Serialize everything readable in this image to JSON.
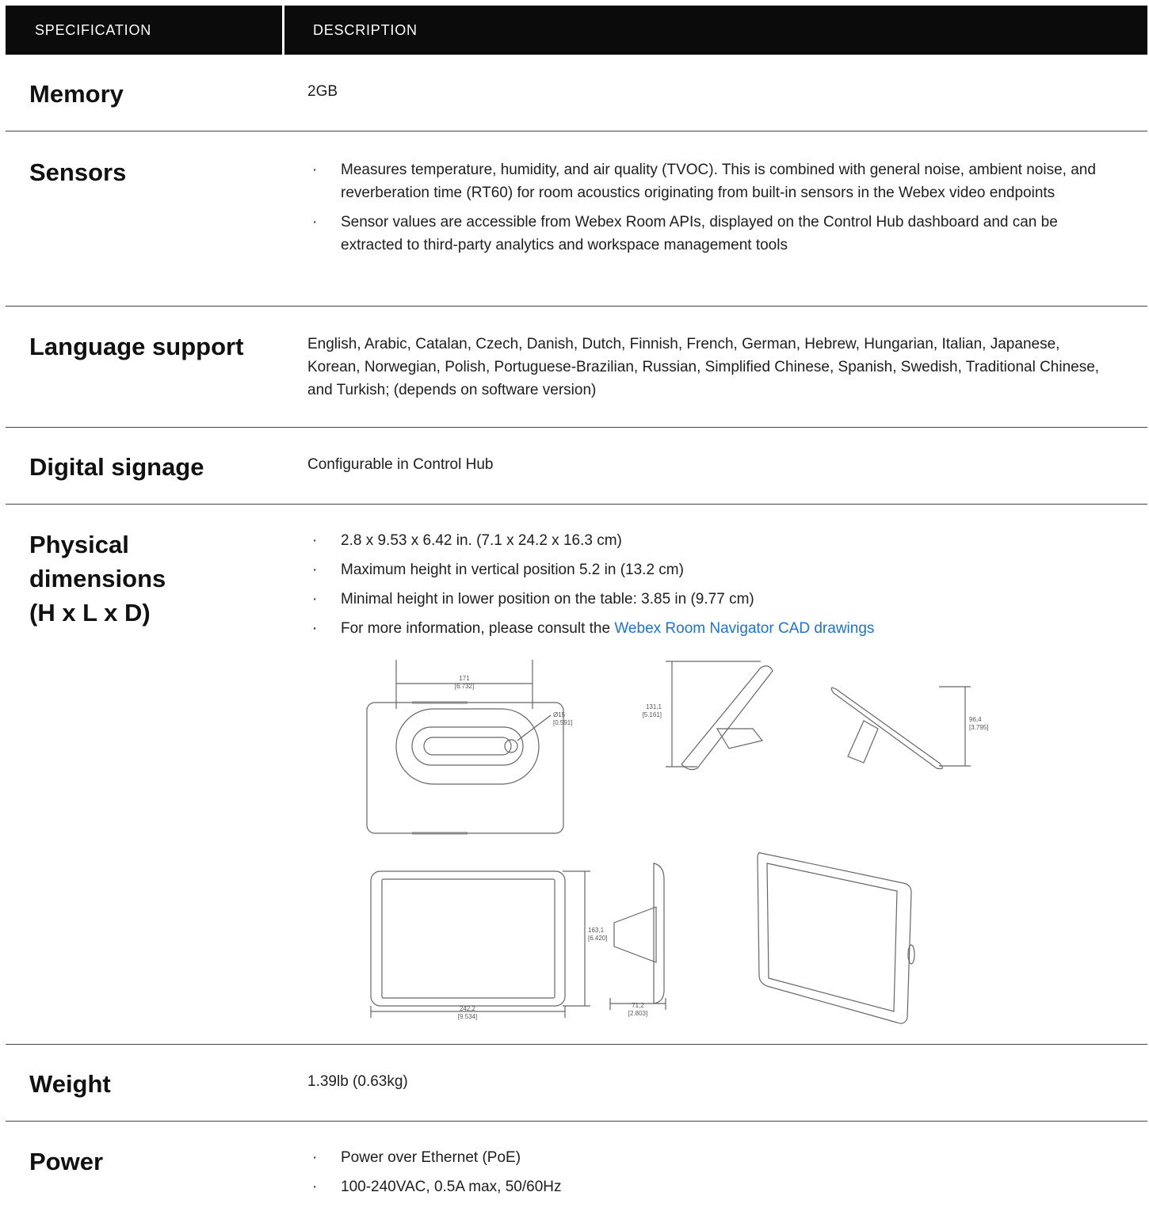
{
  "header": {
    "col1": "SPECIFICATION",
    "col2": "DESCRIPTION"
  },
  "rows": {
    "memory": {
      "label": "Memory",
      "value": "2GB"
    },
    "sensors": {
      "label": "Sensors",
      "items": [
        "Measures temperature, humidity, and air quality (TVOC). This is combined with general noise, ambient noise, and reverberation time (RT60) for room acoustics originating from built-in sensors in the Webex video endpoints",
        "Sensor values are accessible from Webex Room APIs, displayed on the Control Hub dashboard and can be extracted to third-party analytics and workspace management tools"
      ]
    },
    "language": {
      "label": "Language support",
      "value": "English, Arabic, Catalan, Czech, Danish, Dutch, Finnish, French, German, Hebrew, Hungarian, Italian, Japanese, Korean, Norwegian, Polish, Portuguese-Brazilian, Russian, Simplified Chinese, Spanish, Swedish, Traditional Chinese, and Turkish; (depends on software version)"
    },
    "signage": {
      "label": "Digital signage",
      "value": "Configurable in Control Hub"
    },
    "physical": {
      "label_line1": "Physical",
      "label_line2": "dimensions",
      "label_line3": "(H x L x D)",
      "items": [
        "2.8 x 9.53 x 6.42 in. (7.1 x 24.2 x 16.3 cm)",
        "Maximum height in vertical position 5.2 in (13.2 cm)",
        "Minimal height in lower position on the table: 3.85 in (9.77 cm)"
      ],
      "more_prefix": "For more information, please consult the ",
      "more_link": "Webex Room Navigator CAD drawings",
      "drawing_labels": {
        "top_width": "171",
        "top_width_in": "[6.732]",
        "button_dia": "Ø15",
        "button_dia_in": "[0.591]",
        "side_height": "131,1",
        "side_height_in": "[5.161]",
        "low_height": "96,4",
        "low_height_in": "[3.795]",
        "front_height": "163,1",
        "front_height_in": "[6.420]",
        "front_width": "242,2",
        "front_width_in": "[9.534]",
        "depth": "71,2",
        "depth_in": "[2.803]"
      }
    },
    "weight": {
      "label": "Weight",
      "value": "1.39lb (0.63kg)"
    },
    "power": {
      "label": "Power",
      "items": [
        "Power over Ethernet (PoE)",
        "100-240VAC, 0.5A max, 50/60Hz"
      ]
    }
  }
}
